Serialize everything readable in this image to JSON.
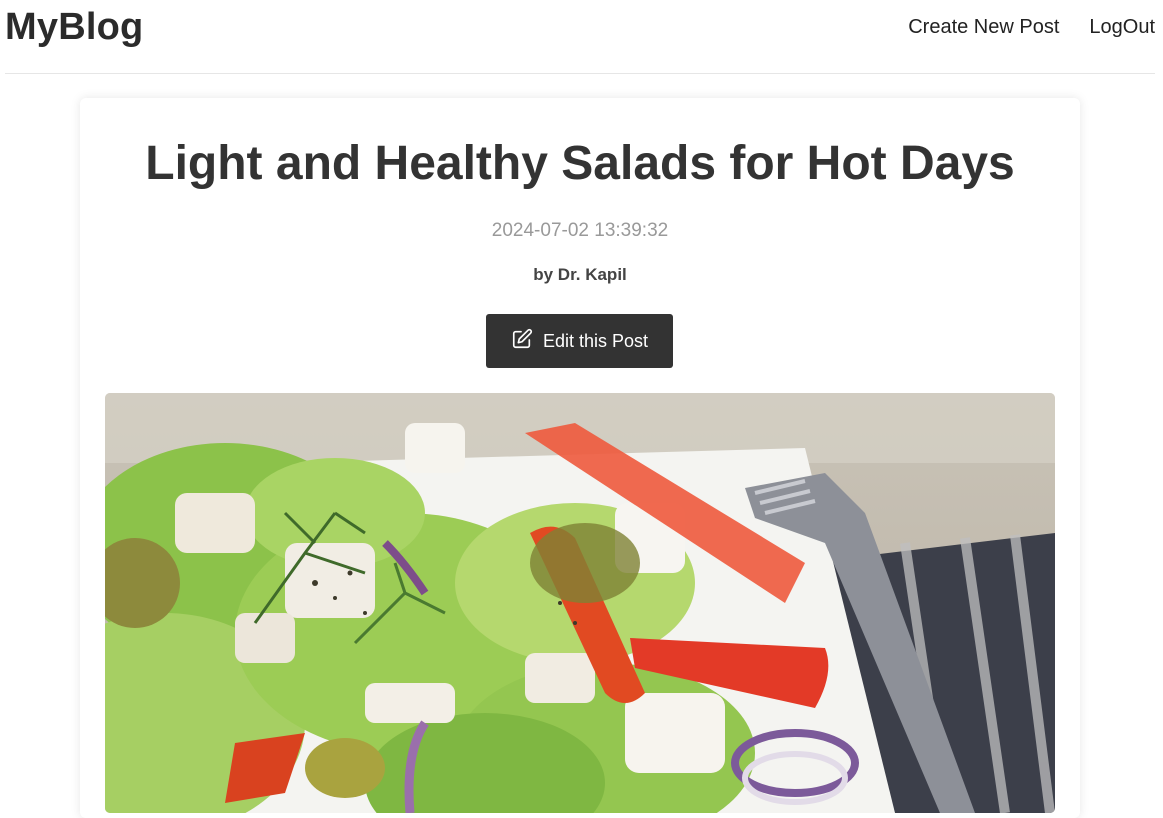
{
  "header": {
    "brand": "MyBlog",
    "nav": {
      "create_label": "Create New Post",
      "logout_label": "LogOut"
    }
  },
  "post": {
    "title": "Light and Healthy Salads for Hot Days",
    "date": "2024-07-02 13:39:32",
    "author": "by Dr. Kapil",
    "edit_label": "Edit this Post",
    "edit_icon": "pencil-square-icon",
    "image_subject": "salad-photo"
  },
  "colors": {
    "button_bg": "#333333",
    "date_text": "#999999"
  }
}
